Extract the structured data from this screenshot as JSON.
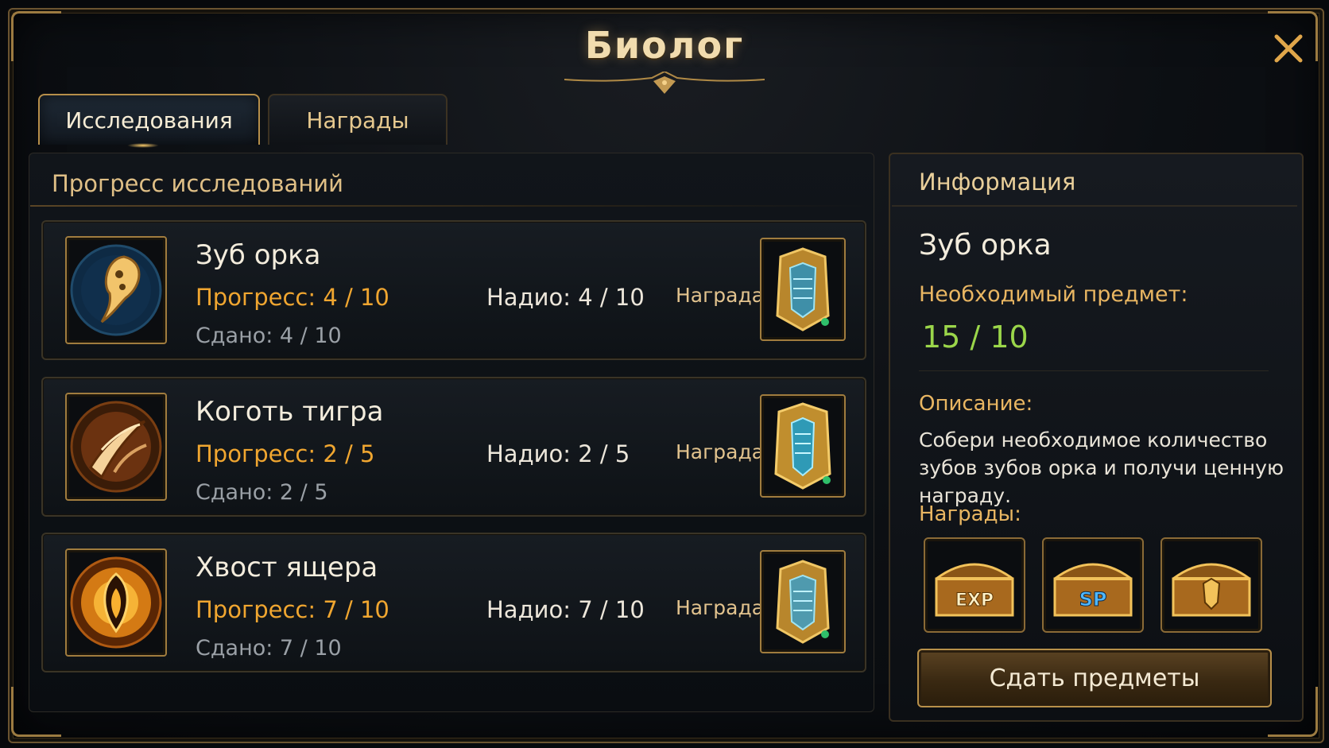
{
  "window": {
    "title": "Биолог"
  },
  "tabs": [
    {
      "label": "Исследования",
      "active": true
    },
    {
      "label": "Награды",
      "active": false
    }
  ],
  "progress_section": {
    "title": "Прогресс исследований"
  },
  "research_items": [
    {
      "name": "Зуб орка",
      "progress": "Прогресс: 4 / 10",
      "given": "Сдано: 4 / 10",
      "have": "Надио: 4 / 10",
      "reward_label": "Награда",
      "icon": "orc-tooth-icon"
    },
    {
      "name": "Коготь тигра",
      "progress": "Прогресс: 2 / 5",
      "given": "Сдано: 2 / 5",
      "have": "Надио: 2 / 5",
      "reward_label": "Награда",
      "icon": "tiger-claw-icon"
    },
    {
      "name": "Хвост ящера",
      "progress": "Прогресс: 7 / 10",
      "given": "Сдано: 7 / 10",
      "have": "Надио: 7 / 10",
      "reward_label": "Награда",
      "icon": "lizard-tail-icon"
    }
  ],
  "info": {
    "title": "Информация",
    "item_name": "Зуб орка",
    "required_label": "Необходимый предмет:",
    "required_value": "15 / 10",
    "description_label": "Описание:",
    "description": "Собери необходимое количество зубов зубов орка и получи ценную награду.",
    "rewards_label": "Награды:",
    "rewards": [
      {
        "icon": "exp-chest-icon",
        "text": "EXP"
      },
      {
        "icon": "sp-chest-icon",
        "text": "SP"
      },
      {
        "icon": "gold-chest-icon",
        "text": ""
      }
    ],
    "submit_label": "Сдать предметы"
  },
  "colors": {
    "gold_border": "#a07c3e",
    "progress_orange": "#f0a630",
    "required_green": "#9bd64a",
    "label_gold": "#e9b662"
  }
}
